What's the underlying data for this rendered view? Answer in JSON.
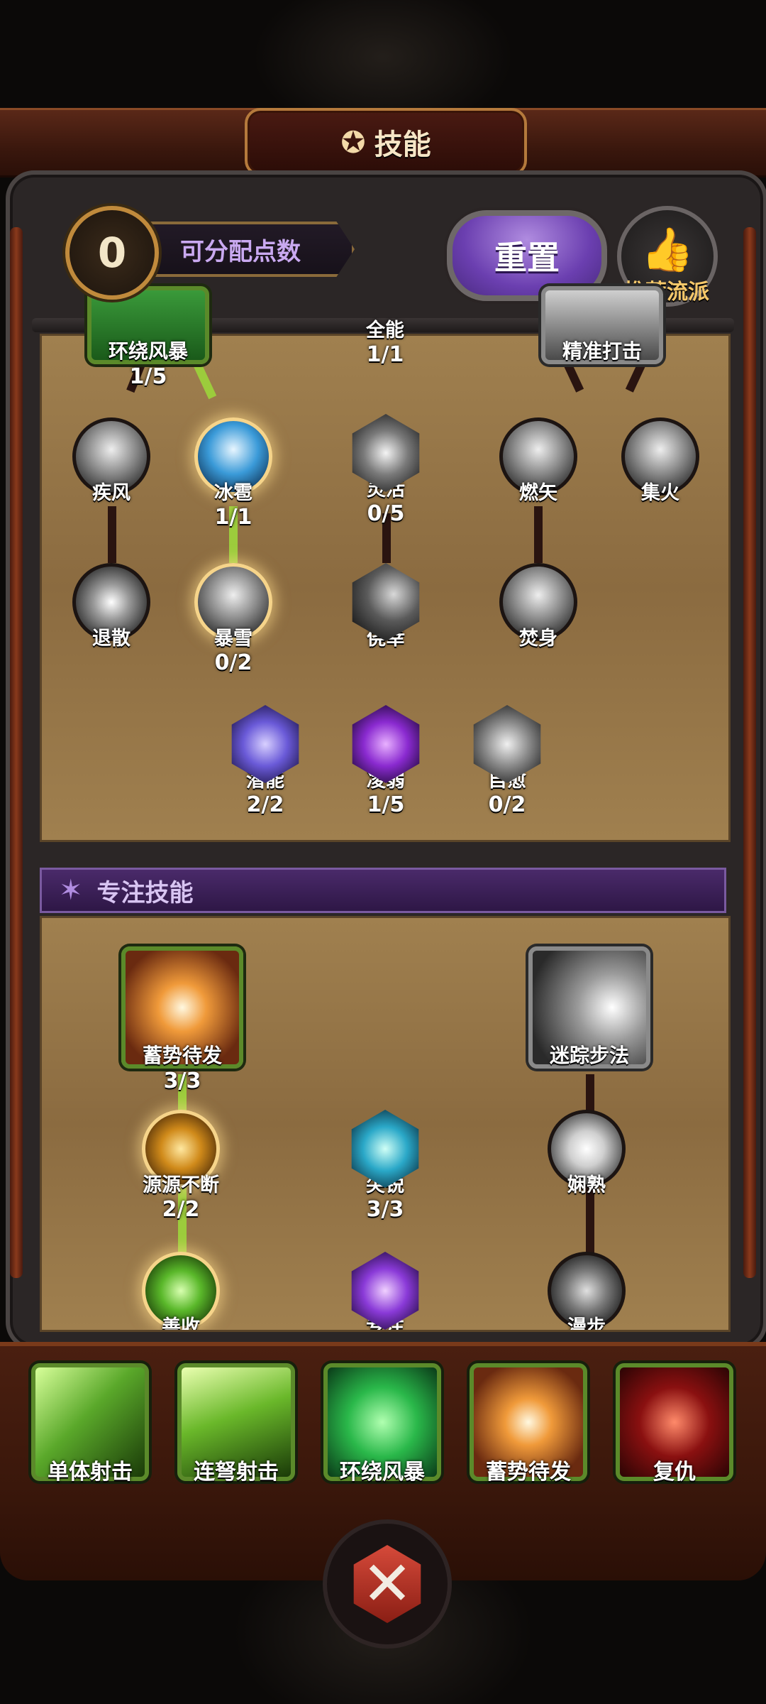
{
  "header": {
    "title": "技能",
    "title_icon": "wheel-icon"
  },
  "points": {
    "value": "0",
    "label": "可分配点数"
  },
  "reset_label": "重置",
  "recommend": {
    "label": "推荐流派",
    "icon": "thumbs-up-icon"
  },
  "tree_top": [
    {
      "name": "环绕风暴",
      "level": "1/5"
    },
    {
      "name": "全能",
      "level": "1/1"
    },
    {
      "name": "精准打击",
      "level": ""
    },
    {
      "name": "疾风",
      "level": ""
    },
    {
      "name": "冰雹",
      "level": "1/1"
    },
    {
      "name": "灵活",
      "level": "0/5"
    },
    {
      "name": "燃矢",
      "level": ""
    },
    {
      "name": "集火",
      "level": ""
    },
    {
      "name": "退散",
      "level": ""
    },
    {
      "name": "暴雪",
      "level": "0/2"
    },
    {
      "name": "侥幸",
      "level": ""
    },
    {
      "name": "焚身",
      "level": ""
    },
    {
      "name": "潜能",
      "level": "2/2"
    },
    {
      "name": "凌弱",
      "level": "1/5"
    },
    {
      "name": "自愈",
      "level": "0/2"
    }
  ],
  "focus_section": {
    "title": "专注技能"
  },
  "tree_focus": [
    {
      "name": "蓄势待发",
      "level": "3/3"
    },
    {
      "name": "迷踪步法",
      "level": ""
    },
    {
      "name": "源源不断",
      "level": "2/2"
    },
    {
      "name": "尖锐",
      "level": "3/3"
    },
    {
      "name": "娴熟",
      "level": ""
    },
    {
      "name": "善收",
      "level": ""
    },
    {
      "name": "专注",
      "level": ""
    },
    {
      "name": "漫步",
      "level": ""
    }
  ],
  "equipped": [
    {
      "name": "单体射击"
    },
    {
      "name": "连弩射击"
    },
    {
      "name": "环绕风暴"
    },
    {
      "name": "蓄势待发"
    },
    {
      "name": "复仇"
    }
  ],
  "colors": {
    "accent_purple": "#6b3fb0",
    "active_line": "#9ccc3c",
    "panel": "#9a7a4a"
  }
}
